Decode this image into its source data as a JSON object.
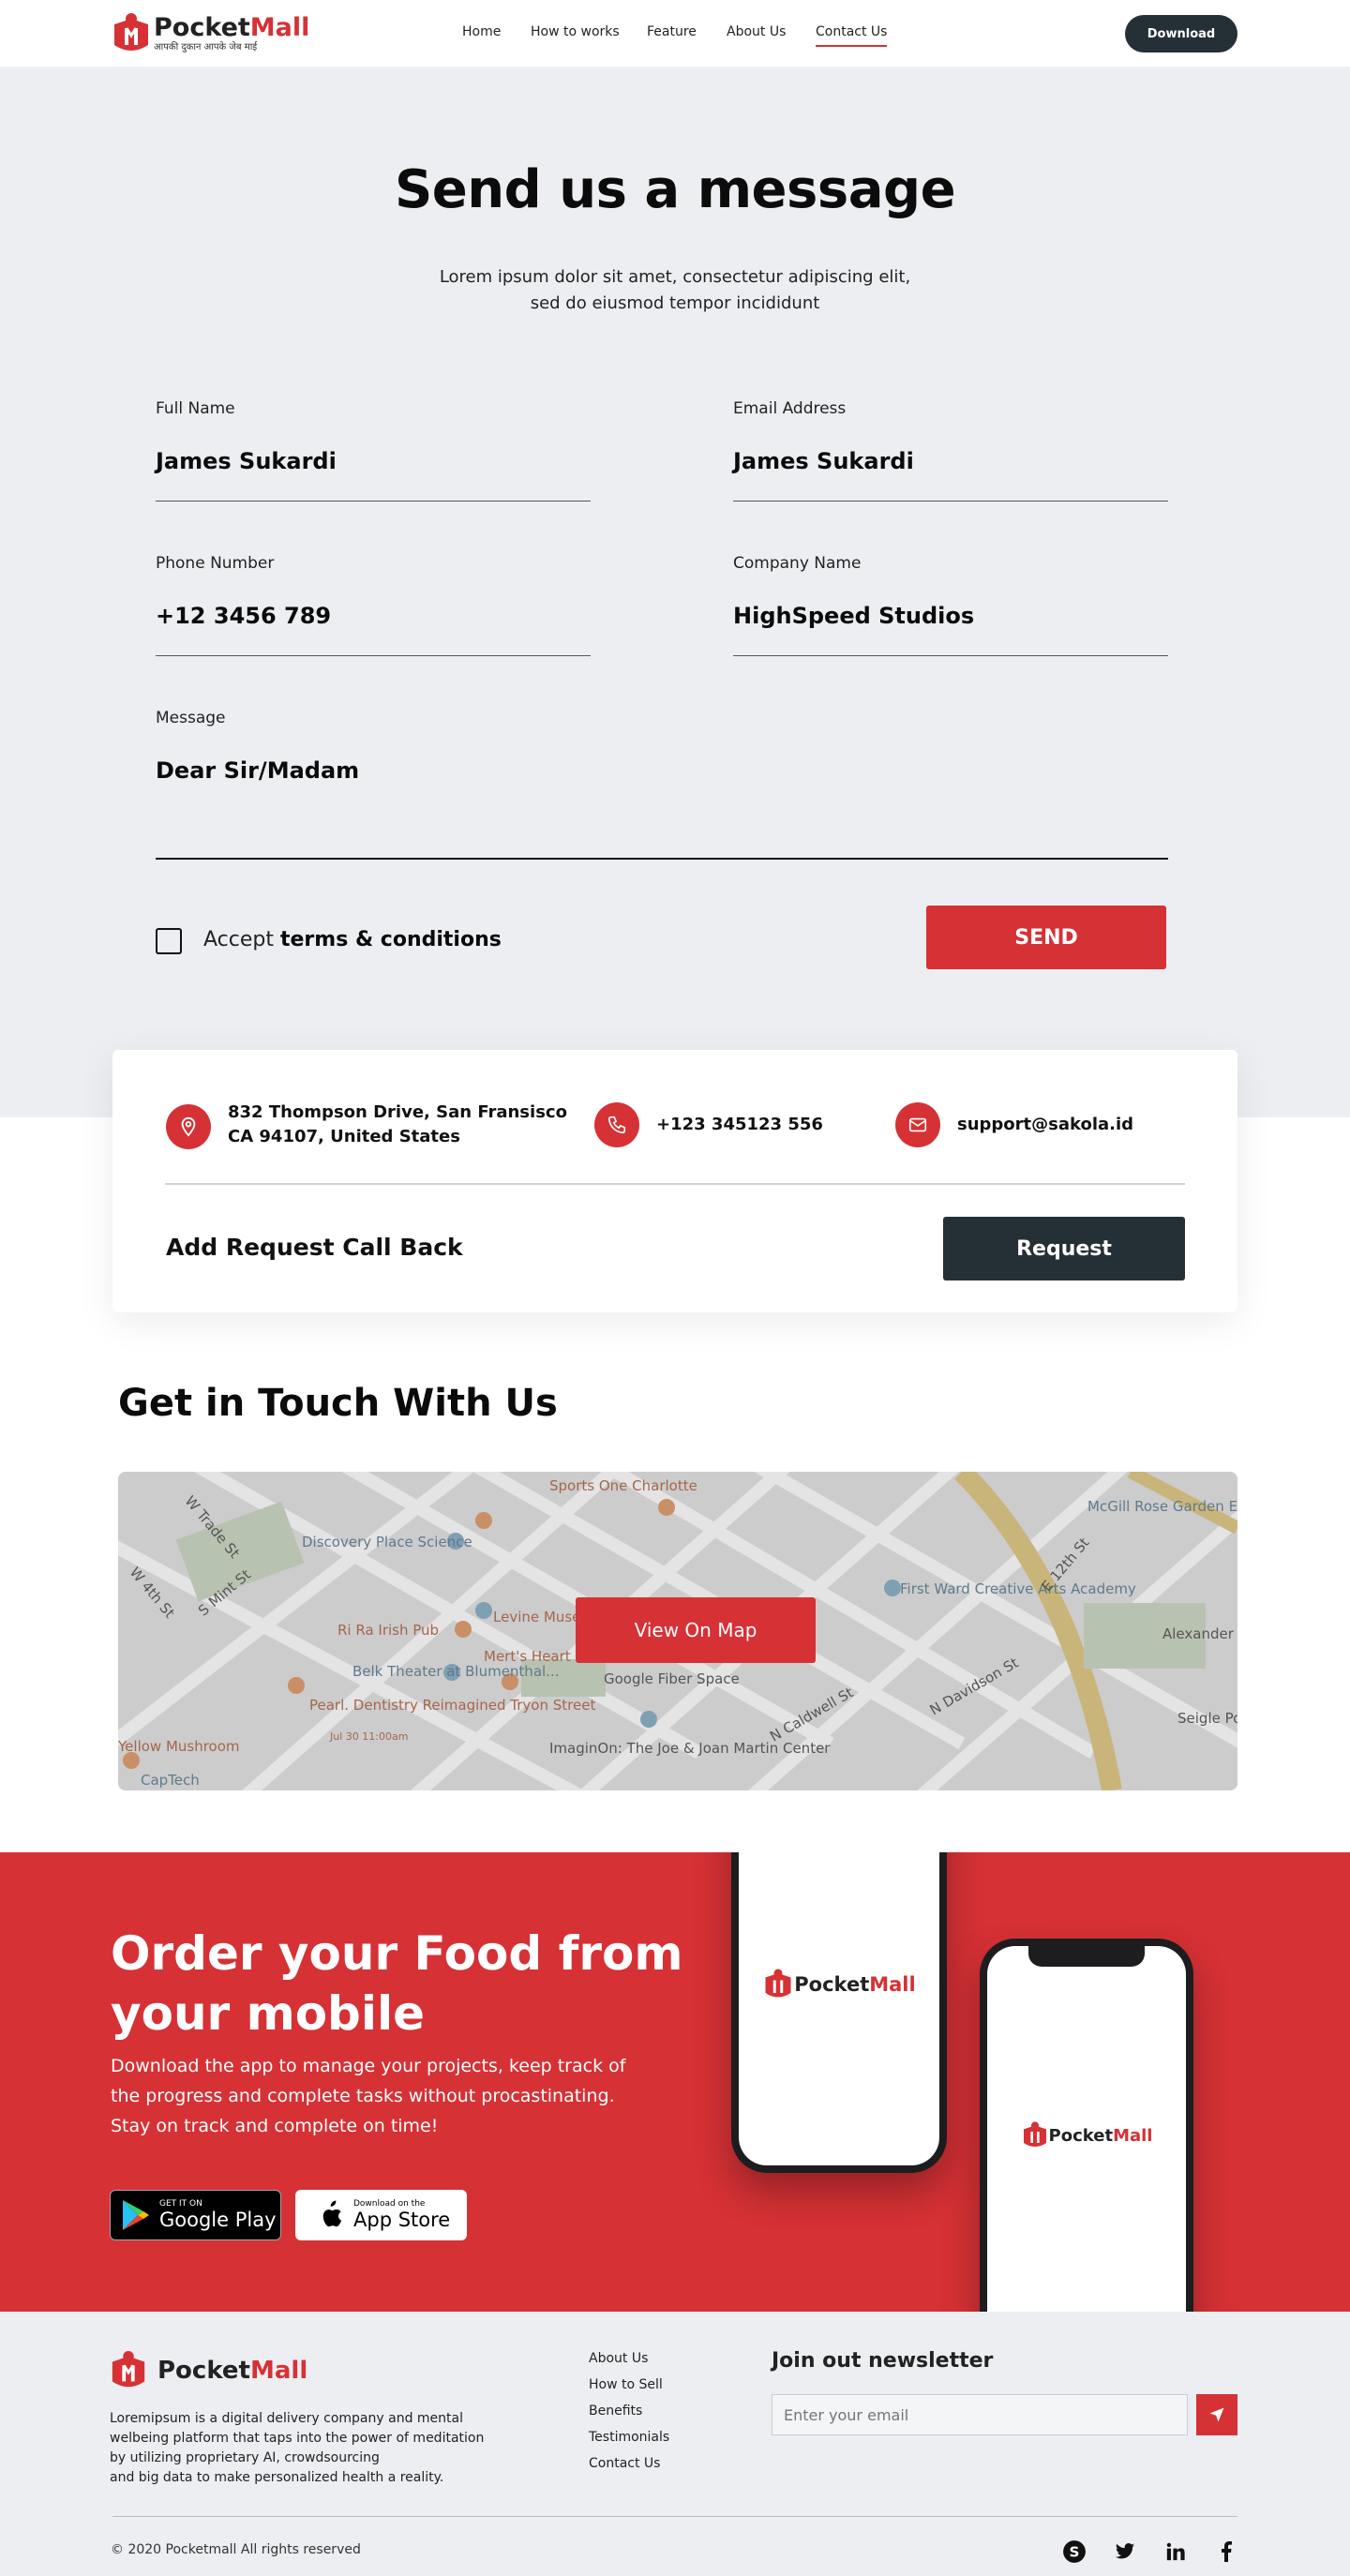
{
  "brand": {
    "name_part1": "Pocket",
    "name_part2": "Mall",
    "tagline": "आपकी दुकान आपके जेब माई",
    "colors": {
      "accent": "#d63135",
      "dark": "#253036",
      "section_bg": "#eceef2"
    }
  },
  "nav": {
    "items": [
      {
        "label": "Home",
        "active": false
      },
      {
        "label": "How to works",
        "active": false
      },
      {
        "label": "Feature",
        "active": false
      },
      {
        "label": "About Us",
        "active": false
      },
      {
        "label": "Contact Us",
        "active": true
      }
    ],
    "download_label": "Download"
  },
  "contact": {
    "title": "Send us a message",
    "subtitle_line1": "Lorem ipsum dolor sit amet, consectetur adipiscing elit,",
    "subtitle_line2": "sed do eiusmod tempor incididunt",
    "fields": {
      "full_name": {
        "label": "Full Name",
        "value": "James Sukardi"
      },
      "email": {
        "label": "Email Address",
        "value": "James Sukardi"
      },
      "phone": {
        "label": "Phone Number",
        "value": "+12 3456 789"
      },
      "company": {
        "label": "Company Name",
        "value": "HighSpeed Studios"
      },
      "message": {
        "label": "Message",
        "value": "Dear Sir/Madam"
      }
    },
    "terms_prefix": "Accept",
    "terms_bold": "terms & conditions",
    "terms_checked": false,
    "send_label": "SEND"
  },
  "info": {
    "address_line1": "832  Thompson Drive, San Fransisco",
    "address_line2": "CA 94107, United States",
    "phone": "+123 345123 556",
    "email": "support@sakola.id",
    "callback_label": "Add Request Call Back",
    "request_label": "Request",
    "icons": [
      "location-pin-icon",
      "phone-icon",
      "mail-icon"
    ]
  },
  "map": {
    "title": "Get in Touch With Us",
    "button_label": "View On Map",
    "labels": [
      "Sports One Charlotte",
      "McGill Rose Garden Events",
      "Discovery Place Science",
      "First Ward Creative Arts Academy",
      "Alexander Street Park",
      "Ri Ra Irish Pub",
      "Levine Museum of the New South",
      "Mert's Heart",
      "Belk Theater at Blumenthal...",
      "Google Fiber Space",
      "Pearl. Dentistry Reimagined Tryon Street",
      "Jul 30 11:00am",
      "ImaginOn: The Joe & Joan Martin Center",
      "Seigle Point Apartment Homes",
      "Yellow Mushroom",
      "CapTech",
      "N Caldwell St",
      "N Davidson St",
      "E 12th St",
      "W Trade St",
      "W 4th St",
      "S Mint St"
    ]
  },
  "app": {
    "title_line1": "Order your Food from",
    "title_line2": "your mobile",
    "desc_line1": "Download the app to manage your projects, keep track of",
    "desc_line2": "the progress and complete tasks without procastinating.",
    "desc_line3": "Stay on track and complete on time!",
    "google_small": "GET IT ON",
    "google_big": "Google Play",
    "apple_small": "Download on the",
    "apple_big": "App Store"
  },
  "footer": {
    "desc_line1": "Loremipsum is a digital delivery company and mental",
    "desc_line2": "welbeing platform that taps into the power of meditation",
    "desc_line3": "by utilizing proprietary AI, crowdsourcing",
    "desc_line4": "and big data to make personalized health a reality.",
    "links": [
      "About Us",
      "How to Sell",
      "Benefits",
      "Testimonials",
      "Contact Us"
    ],
    "newsletter_title": "Join out newsletter",
    "newsletter_placeholder": "Enter your email",
    "copyright": "© 2020  Pocketmall All rights reserved",
    "social_icons": [
      "skype-icon",
      "twitter-icon",
      "linkedin-icon",
      "facebook-icon"
    ]
  }
}
